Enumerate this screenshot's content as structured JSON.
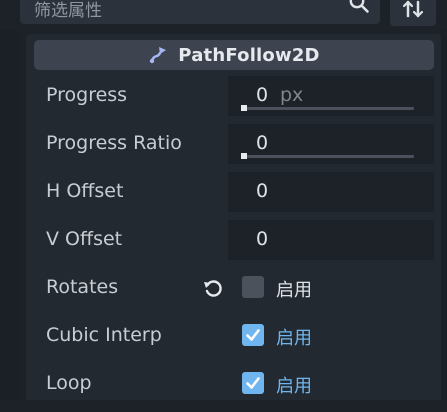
{
  "filter": {
    "placeholder": "筛选属性"
  },
  "icons": {
    "search": "search-icon",
    "sort": "sort-icon",
    "class": "path-follow-icon",
    "revert": "revert-icon",
    "check": "checkmark-icon"
  },
  "colors": {
    "accent": "#6fb6f0",
    "panel": "#232930",
    "header": "#3d444f",
    "editor": "#1d2229"
  },
  "inspector": {
    "class_name": "PathFollow2D",
    "properties": {
      "progress": {
        "label": "Progress",
        "value": "0",
        "unit": "px"
      },
      "progress_ratio": {
        "label": "Progress Ratio",
        "value": "0"
      },
      "h_offset": {
        "label": "H Offset",
        "value": "0"
      },
      "v_offset": {
        "label": "V Offset",
        "value": "0"
      },
      "rotates": {
        "label": "Rotates",
        "checked": false,
        "check_label": "启用"
      },
      "cubic_interp": {
        "label": "Cubic Interp",
        "checked": true,
        "check_label": "启用"
      },
      "loop": {
        "label": "Loop",
        "checked": true,
        "check_label": "启用"
      }
    }
  }
}
